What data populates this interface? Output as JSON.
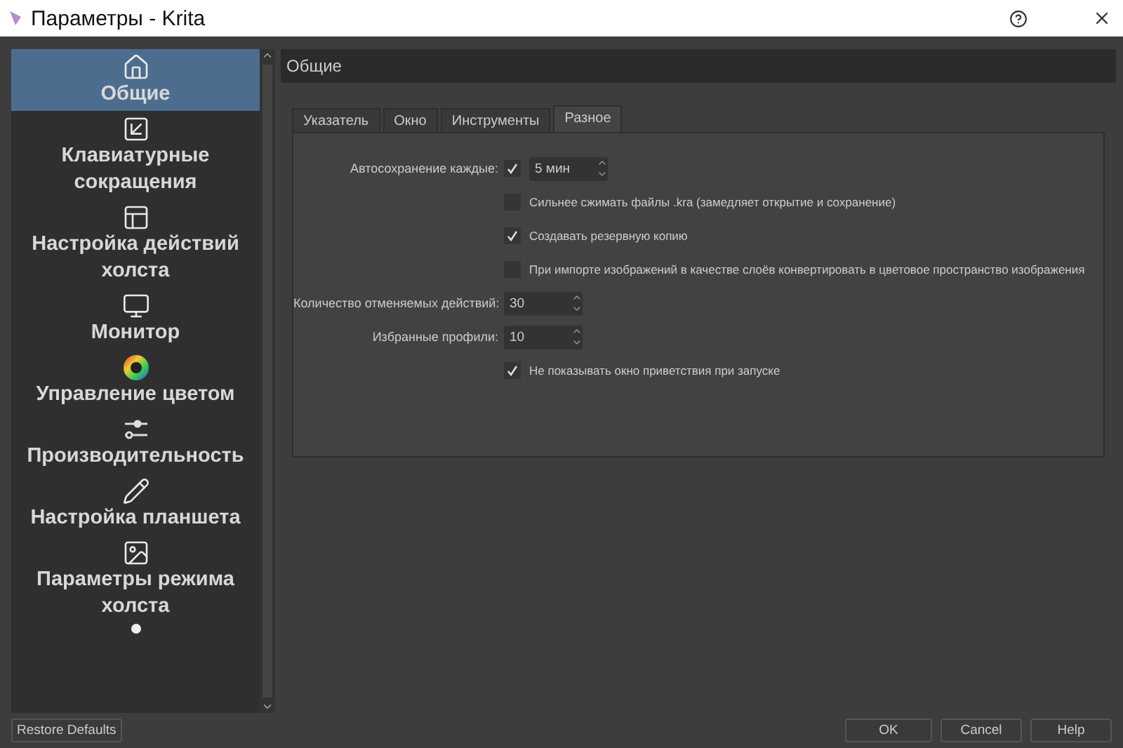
{
  "window": {
    "title": "Параметры - Krita"
  },
  "sidebar": {
    "items": [
      {
        "label": "Общие",
        "selected": true
      },
      {
        "label": "Клавиатурные сокращения",
        "selected": false
      },
      {
        "label": "Настройка действий холста",
        "selected": false
      },
      {
        "label": "Монитор",
        "selected": false
      },
      {
        "label": "Управление цветом",
        "selected": false
      },
      {
        "label": "Производительность",
        "selected": false
      },
      {
        "label": "Настройка планшета",
        "selected": false
      },
      {
        "label": "Параметры режима холста",
        "selected": false
      }
    ]
  },
  "page_title": "Общие",
  "tabs": [
    {
      "label": "Указатель",
      "selected": false
    },
    {
      "label": "Окно",
      "selected": false
    },
    {
      "label": "Инструменты",
      "selected": false
    },
    {
      "label": "Разное",
      "selected": true
    }
  ],
  "settings": [
    {
      "kind": "checkspin",
      "label": "Автосохранение каждые:",
      "checked": true,
      "value": "5 мин"
    },
    {
      "kind": "checkbox",
      "label": "Сильнее сжимать файлы .kra (замедляет открытие и сохранение)",
      "checked": false
    },
    {
      "kind": "checkbox",
      "label": "Создавать резервную копию",
      "checked": true
    },
    {
      "kind": "checkbox",
      "label": "При импорте изображений в качестве слоёв конвертировать в цветовое пространство изображения",
      "checked": false
    },
    {
      "kind": "spin",
      "label": "Количество отменяемых действий:",
      "value": "30"
    },
    {
      "kind": "spin",
      "label": "Избранные профили:",
      "value": "10"
    },
    {
      "kind": "checkbox",
      "label": "Не показывать окно приветствия при запуске",
      "checked": true
    }
  ],
  "buttons": {
    "restore": "Restore Defaults",
    "ok": "OK",
    "cancel": "Cancel",
    "help": "Help"
  }
}
